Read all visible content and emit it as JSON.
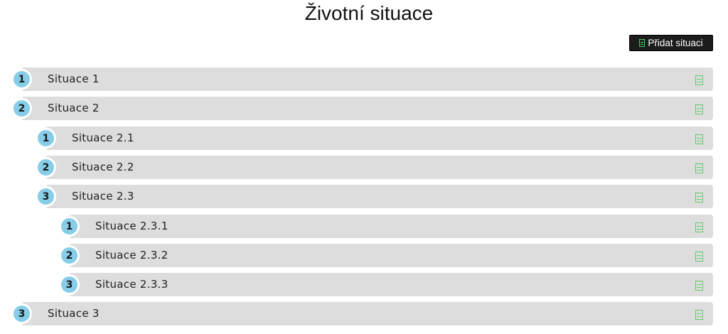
{
  "header": {
    "title": "Životní situace",
    "add_button_label": "Přidat situaci",
    "add_button_icon": "document-icon"
  },
  "colors": {
    "badge": "#87cde8",
    "row_background": "#dddddd",
    "action_icon": "#5fc96a",
    "button_background": "#1c1c1c"
  },
  "tree": {
    "items": [
      {
        "number": "1",
        "label": "Situace 1",
        "level": 1,
        "action_icon": "document-icon"
      },
      {
        "number": "2",
        "label": "Situace 2",
        "level": 1,
        "action_icon": "document-icon"
      },
      {
        "number": "1",
        "label": "Situace 2.1",
        "level": 2,
        "action_icon": "document-icon"
      },
      {
        "number": "2",
        "label": "Situace 2.2",
        "level": 2,
        "action_icon": "document-icon"
      },
      {
        "number": "3",
        "label": "Situace 2.3",
        "level": 2,
        "action_icon": "document-icon"
      },
      {
        "number": "1",
        "label": "Situace 2.3.1",
        "level": 3,
        "action_icon": "document-icon"
      },
      {
        "number": "2",
        "label": "Situace 2.3.2",
        "level": 3,
        "action_icon": "document-icon"
      },
      {
        "number": "3",
        "label": "Situace 2.3.3",
        "level": 3,
        "action_icon": "document-icon"
      },
      {
        "number": "3",
        "label": "Situace 3",
        "level": 1,
        "action_icon": "document-icon"
      }
    ]
  }
}
